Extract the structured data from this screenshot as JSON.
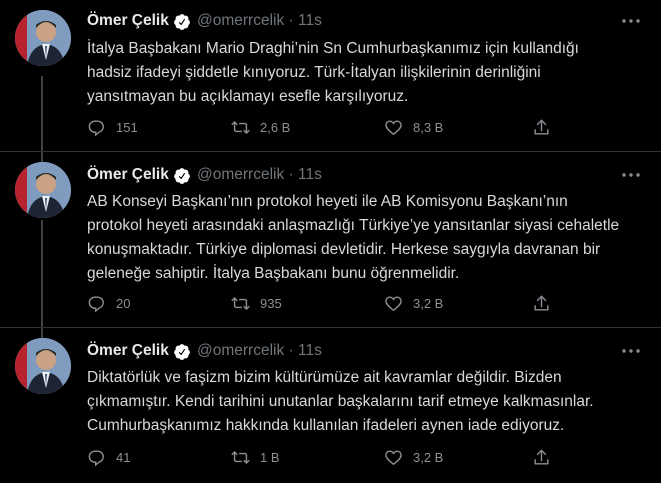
{
  "tweets": [
    {
      "name": "Ömer Çelik",
      "handle": "@omerrcelik",
      "time": "11s",
      "lines": [
        "İtalya Başbakanı Mario Draghi’nin Sn Cumhurbaşkanımız için kullandığı",
        "hadsiz ifadeyi şiddetle kınıyoruz. Türk-İtalyan ilişkilerinin derinliğini",
        "yansıtmayan bu açıklamayı esefle karşılıyoruz."
      ],
      "replies": "151",
      "retweets": "2,6 B",
      "likes": "8,3 B"
    },
    {
      "name": "Ömer Çelik",
      "handle": "@omerrcelik",
      "time": "11s",
      "lines": [
        "AB Konseyi Başkanı’nın protokol heyeti ile AB Komisyonu Başkanı’nın",
        "protokol heyeti arasındaki anlaşmazlığı Türkiye’ye yansıtanlar siyasi cehaletle",
        "konuşmaktadır. Türkiye diplomasi devletidir. Herkese saygıyla davranan bir",
        "geleneğe sahiptir. İtalya Başbakanı bunu öğrenmelidir."
      ],
      "replies": "20",
      "retweets": "935",
      "likes": "3,2 B"
    },
    {
      "name": "Ömer Çelik",
      "handle": "@omerrcelik",
      "time": "11s",
      "lines": [
        "Diktatörlük ve faşizm bizim kültürümüze ait kavramlar değildir. Bizden",
        "çıkmamıştır. Kendi tarihini unutanlar başkalarını tarif etmeye kalkmasınlar.",
        "Cumhurbaşkanımız hakkında kullanılan ifadeleri aynen iade ediyoruz."
      ],
      "replies": "41",
      "retweets": "1 B",
      "likes": "3,2 B"
    }
  ],
  "icons": {
    "reply": "reply-icon",
    "retweet": "retweet-icon",
    "like": "heart-icon",
    "share": "share-icon",
    "verified": "verified-badge-icon",
    "more": "more-options-icon"
  },
  "colors": {
    "background": "#000000",
    "text": "#d9d9d9",
    "muted": "#71767b",
    "verified_badge": "#ffffff"
  }
}
